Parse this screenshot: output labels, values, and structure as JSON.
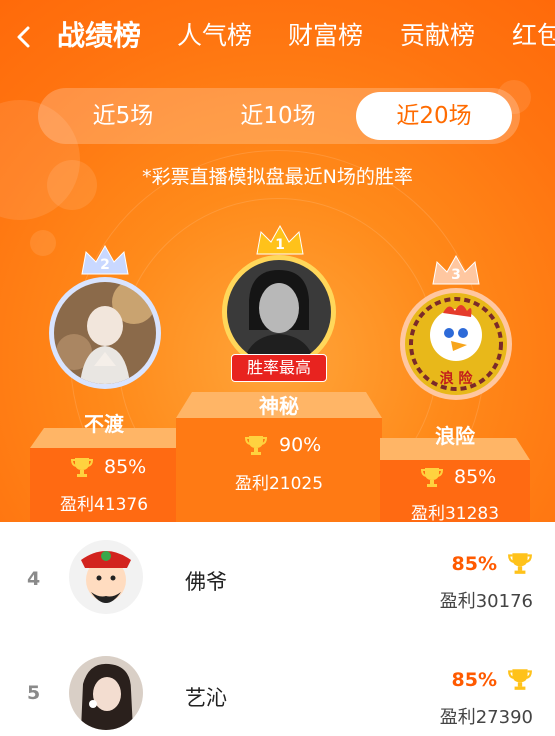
{
  "tabs": [
    "战绩榜",
    "人气榜",
    "财富榜",
    "贡献榜",
    "红包"
  ],
  "segment": {
    "options": [
      "近5场",
      "近10场",
      "近20场"
    ],
    "selected": "近20场"
  },
  "note": "*彩票直播模拟盘最近N场的胜率",
  "podium": [
    {
      "rank": "2",
      "name": "不渡",
      "rate": "85%",
      "profit": "盈利41376"
    },
    {
      "rank": "1",
      "name": "神秘",
      "rate": "90%",
      "profit": "盈利21025",
      "badge": "胜率最高"
    },
    {
      "rank": "3",
      "name": "浪险",
      "rate": "85%",
      "profit": "盈利31283"
    }
  ],
  "avatar_text_rank3": "浪  险",
  "list": [
    {
      "rank": "4",
      "name": "佛爷",
      "rate": "85%",
      "profit": "盈利30176"
    },
    {
      "rank": "5",
      "name": "艺沁",
      "rate": "85%",
      "profit": "盈利27390"
    }
  ],
  "colors": {
    "accent": "#ff7410",
    "badge": "#e8231f",
    "rate_text": "#ff5a00",
    "crown_gold": "#ffc21a"
  },
  "icons": [
    "back-arrow-icon",
    "crown-icon",
    "trophy-icon"
  ]
}
